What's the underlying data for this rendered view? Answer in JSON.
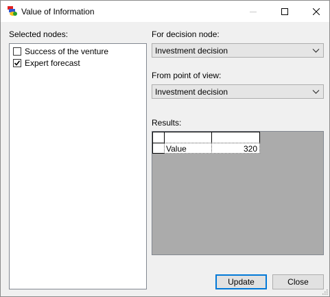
{
  "window": {
    "title": "Value of Information",
    "icon": "app-icon",
    "controls": [
      "minimize-icon",
      "maximize-icon",
      "close-icon"
    ]
  },
  "selected_nodes": {
    "label": "Selected nodes:",
    "items": [
      {
        "label": "Success of the venture",
        "checked": false
      },
      {
        "label": "Expert forecast",
        "checked": true
      }
    ]
  },
  "decision_node": {
    "label": "For decision node:",
    "value": "Investment decision"
  },
  "point_of_view": {
    "label": "From point of view:",
    "value": "Investment decision"
  },
  "results": {
    "label": "Results:",
    "rows": [
      {
        "name": "Value",
        "value": "320"
      }
    ]
  },
  "buttons": {
    "update": "Update",
    "close": "Close"
  }
}
